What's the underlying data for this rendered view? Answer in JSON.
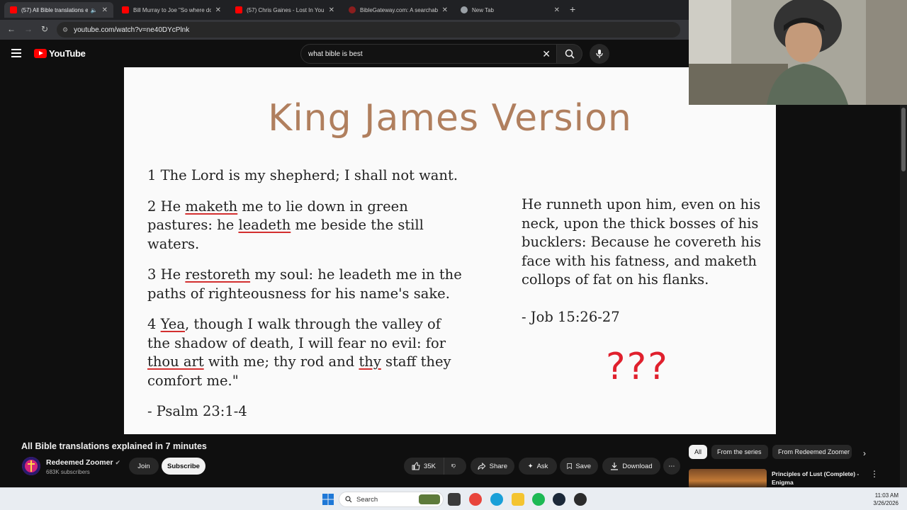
{
  "browser": {
    "tabs": [
      {
        "label": "(57) All Bible translations e",
        "active": true,
        "muted": false,
        "favicon": "youtube-icon"
      },
      {
        "label": "Bill Murray to Joe \"So where do",
        "active": false,
        "favicon": "youtube-icon"
      },
      {
        "label": "(57) Chris Gaines - Lost In You (",
        "active": false,
        "favicon": "youtube-icon"
      },
      {
        "label": "BibleGateway.com: A searchabl",
        "active": false,
        "favicon": "biblegateway-icon"
      },
      {
        "label": "New Tab",
        "active": false,
        "favicon": "chrome-icon"
      }
    ],
    "url": "youtube.com/watch?v=ne40DYcPlnk"
  },
  "youtube": {
    "logo_text": "YouTube",
    "search_value": "what bible is best"
  },
  "slide": {
    "title": "King James Version",
    "verse1": "1 The Lord is my shepherd; I shall not want.",
    "verse2": {
      "a": "2 He ",
      "b": "maketh",
      "c": " me to lie down in green pastures: he ",
      "d": "leadeth",
      "e": " me beside the still waters."
    },
    "verse3": {
      "a": "3 He ",
      "b": "restoreth",
      "c": " my soul: he leadeth me in the paths of righteousness for his name's sake."
    },
    "verse4": {
      "a": "4 ",
      "b": "Yea",
      "c": ", though I walk through the valley of the shadow of death, I will fear no evil: for ",
      "d": "thou art",
      "e": " with me; thy rod and ",
      "f": "thy",
      "g": " staff they comfort me.\""
    },
    "psalm_ref": "- Psalm 23:1-4",
    "job_text": "He runneth upon him, even on his neck, upon the thick bosses of his bucklers: Because he covereth his face with his fatness, and maketh collops of fat on his flanks.",
    "job_ref": "- Job 15:26-27",
    "question_marks": "???"
  },
  "video": {
    "title": "All Bible translations explained in 7 minutes",
    "channel": "Redeemed Zoomer",
    "subscribers": "683K subscribers",
    "join_label": "Join",
    "subscribe_label": "Subscribe",
    "likes": "35K",
    "share_label": "Share",
    "ask_label": "Ask",
    "save_label": "Save",
    "download_label": "Download"
  },
  "sidebar": {
    "chips": [
      "All",
      "From the series",
      "From Redeemed Zoomer"
    ],
    "reco_title": "Principles of Lust (Complete) - Enigma"
  },
  "taskbar": {
    "search_placeholder": "Search",
    "time": "11:03 AM",
    "date": "3/26/2026"
  },
  "colors": {
    "youtube_red": "#ff0000",
    "slide_title": "#b07f5e",
    "underline_red": "#d32f2f",
    "question_red": "#e0202d"
  }
}
